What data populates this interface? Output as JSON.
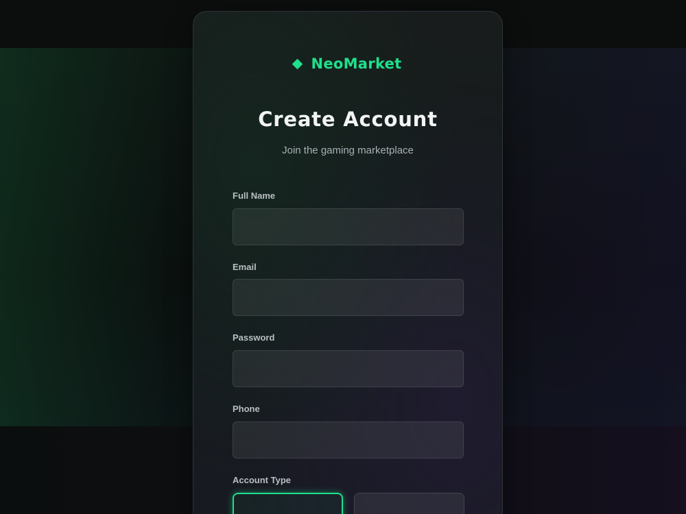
{
  "brand": {
    "name": "NeoMarket",
    "icon": "diamond-icon",
    "accent_color": "#1fe08c"
  },
  "header": {
    "title": "Create Account",
    "subtitle": "Join the gaming marketplace"
  },
  "form": {
    "full_name": {
      "label": "Full Name",
      "value": "",
      "placeholder": ""
    },
    "email": {
      "label": "Email",
      "value": "",
      "placeholder": ""
    },
    "password": {
      "label": "Password",
      "value": "",
      "placeholder": ""
    },
    "phone": {
      "label": "Phone",
      "value": "",
      "placeholder": ""
    },
    "account_type": {
      "label": "Account Type",
      "selected_index": 0
    }
  }
}
